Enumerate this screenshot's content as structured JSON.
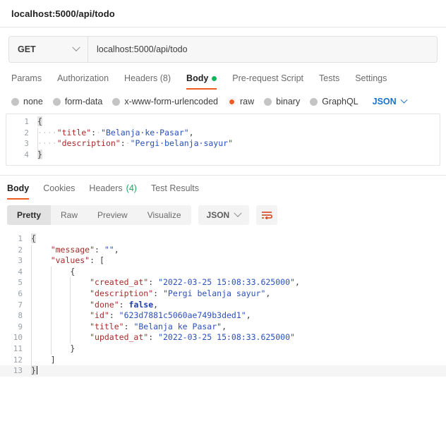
{
  "header": {
    "title": "localhost:5000/api/todo"
  },
  "request_bar": {
    "method": "GET",
    "method_icon": "chevron-down-icon",
    "url": "localhost:5000/api/todo"
  },
  "request_tabs": [
    {
      "label": "Params",
      "active": false
    },
    {
      "label": "Authorization",
      "active": false
    },
    {
      "label": "Headers (8)",
      "active": false
    },
    {
      "label": "Body",
      "active": true,
      "dot": "green"
    },
    {
      "label": "Pre-request Script",
      "active": false
    },
    {
      "label": "Tests",
      "active": false
    },
    {
      "label": "Settings",
      "active": false
    }
  ],
  "body_types": [
    {
      "label": "none",
      "selected": false
    },
    {
      "label": "form-data",
      "selected": false
    },
    {
      "label": "x-www-form-urlencoded",
      "selected": false
    },
    {
      "label": "raw",
      "selected": true
    },
    {
      "label": "binary",
      "selected": false
    },
    {
      "label": "GraphQL",
      "selected": false
    }
  ],
  "body_format": {
    "label": "JSON",
    "icon": "chevron-down-icon"
  },
  "request_body": {
    "lines": [
      {
        "n": "1",
        "text": "{"
      },
      {
        "n": "2",
        "text": "    \"title\": \"Belanja ke Pasar\","
      },
      {
        "n": "3",
        "text": "    \"description\": \"Pergi belanja sayur\""
      },
      {
        "n": "4",
        "text": "}"
      }
    ]
  },
  "response_tabs": [
    {
      "label": "Body",
      "active": true
    },
    {
      "label": "Cookies",
      "active": false
    },
    {
      "label": "Headers",
      "count": "(4)",
      "active": false
    },
    {
      "label": "Test Results",
      "active": false
    }
  ],
  "response_toolbar": {
    "views": [
      {
        "label": "Pretty",
        "active": true
      },
      {
        "label": "Raw",
        "active": false
      },
      {
        "label": "Preview",
        "active": false
      },
      {
        "label": "Visualize",
        "active": false
      }
    ],
    "format": {
      "label": "JSON",
      "icon": "chevron-down-icon"
    },
    "wrap_icon": "word-wrap-icon"
  },
  "response_body": {
    "lines": [
      {
        "n": "1",
        "text": "{"
      },
      {
        "n": "2",
        "text": "    \"message\": \"\","
      },
      {
        "n": "3",
        "text": "    \"values\": ["
      },
      {
        "n": "4",
        "text": "        {"
      },
      {
        "n": "5",
        "text": "            \"created_at\": \"2022-03-25 15:08:33.625000\","
      },
      {
        "n": "6",
        "text": "            \"description\": \"Pergi belanja sayur\","
      },
      {
        "n": "7",
        "text": "            \"done\": false,"
      },
      {
        "n": "8",
        "text": "            \"id\": \"623d7881c5060ae749b3ded1\","
      },
      {
        "n": "9",
        "text": "            \"title\": \"Belanja ke Pasar\","
      },
      {
        "n": "10",
        "text": "            \"updated_at\": \"2022-03-25 15:08:33.625000\""
      },
      {
        "n": "11",
        "text": "        }"
      },
      {
        "n": "12",
        "text": "    ]"
      },
      {
        "n": "13",
        "text": "}"
      }
    ],
    "parsed": {
      "message": "",
      "values": [
        {
          "created_at": "2022-03-25 15:08:33.625000",
          "description": "Pergi belanja sayur",
          "done": false,
          "id": "623d7881c5060ae749b3ded1",
          "title": "Belanja ke Pasar",
          "updated_at": "2022-03-25 15:08:33.625000"
        }
      ]
    }
  },
  "colors": {
    "accent": "#ef5b25",
    "link": "#1a73c8",
    "green": "#13b55a",
    "count_green": "#1fa463",
    "key": "#a52a2a",
    "string": "#2b50b8",
    "boolean": "#1d3fad"
  }
}
